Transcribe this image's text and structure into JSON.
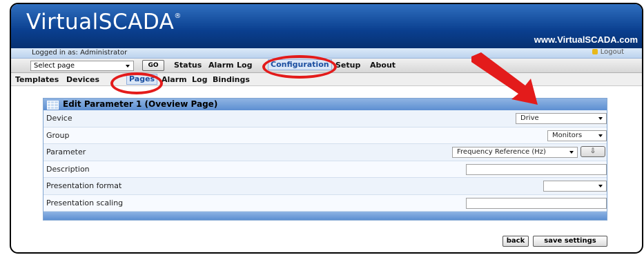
{
  "app": {
    "brand": "VirtualSCADA",
    "registered": "®",
    "site_url": "www.VirtualSCADA.com"
  },
  "login": {
    "status": "Logged in as: Administrator",
    "logout_label": "Logout"
  },
  "navbar": {
    "select_page": "Select page",
    "go_label": "GO",
    "items": [
      "Status",
      "Alarm",
      "Log",
      "Configuration",
      "Setup",
      "About"
    ],
    "active": "Configuration"
  },
  "subnav": {
    "items": [
      "Templates",
      "Devices",
      "Pages",
      "Alarm",
      "Log",
      "Bindings"
    ],
    "active": "Pages"
  },
  "panel": {
    "title": "Edit Parameter 1 (Oveview Page)",
    "rows": [
      {
        "label": "Device",
        "value": "Drive"
      },
      {
        "label": "Group",
        "value": "Monitors"
      },
      {
        "label": "Parameter",
        "value": "Frequency Reference (Hz)"
      },
      {
        "label": "Description",
        "value": ""
      },
      {
        "label": "Presentation format",
        "value": ""
      },
      {
        "label": "Presentation scaling",
        "value": ""
      }
    ]
  },
  "buttons": {
    "back": "back",
    "save": "save settings"
  },
  "colors": {
    "banner": "#0a3f8f",
    "accent": "#5d8fd2",
    "highlight": "#e31b1b"
  }
}
